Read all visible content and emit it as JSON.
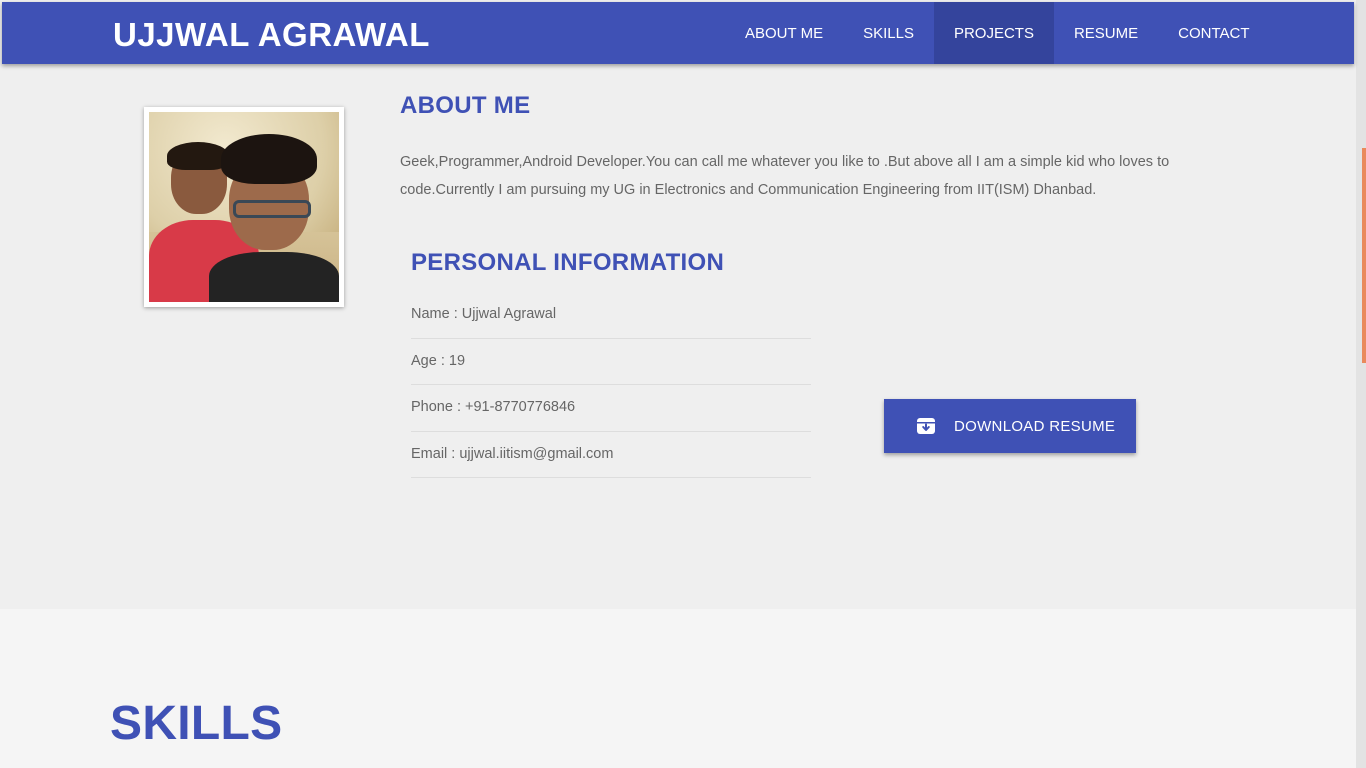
{
  "nav": {
    "brand": "UJJWAL AGRAWAL",
    "items": [
      {
        "label": "ABOUT ME"
      },
      {
        "label": "SKILLS"
      },
      {
        "label": "PROJECTS"
      },
      {
        "label": "RESUME"
      },
      {
        "label": "CONTACT"
      }
    ],
    "active": "PROJECTS"
  },
  "about": {
    "title": "ABOUT ME",
    "text": "Geek,Programmer,Android Developer.You can call me whatever you like to .But above all I am a simple kid who loves to code.Currently I am pursuing my UG in Electronics and Communication Engineering from IIT(ISM) Dhanbad.",
    "personal_title": "PERSONAL INFORMATION",
    "info": [
      "Name : Ujjwal Agrawal",
      "Age : 19",
      "Phone : +91-8770776846",
      "Email : ujjwal.iitism@gmail.com"
    ],
    "download_label": "DOWNLOAD RESUME",
    "download_icon": "archive-download-icon"
  },
  "skills": {
    "title": "SKILLS"
  },
  "colors": {
    "primary": "#3f51b5",
    "active_nav": "#34449c",
    "text": "#666666",
    "scroll_thumb": "#e9895b"
  }
}
